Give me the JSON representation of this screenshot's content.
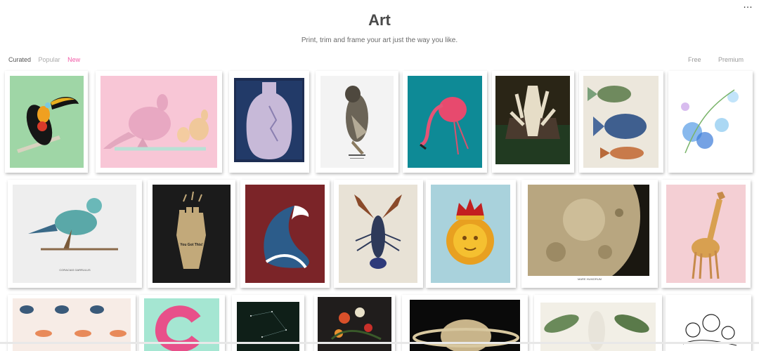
{
  "header": {
    "title": "Art",
    "subtitle": "Print, trim and frame your art just the way you like."
  },
  "menu": {
    "icon": "more-dots-icon",
    "glyph": "…"
  },
  "filters": {
    "curated": "Curated",
    "popular": "Popular",
    "new": "New",
    "active_color": "#f25aa7"
  },
  "tiers": {
    "free": "Free",
    "premium": "Premium"
  },
  "artworks": [
    {
      "name": "toucan",
      "bg": "#9fd6a6"
    },
    {
      "name": "kangaroos",
      "bg": "#f8c6d6"
    },
    {
      "name": "blue-vase",
      "bg": "#1d2d52"
    },
    {
      "name": "owl",
      "bg": "#f3f3f3"
    },
    {
      "name": "flamingo",
      "bg": "#0e8a96"
    },
    {
      "name": "skeleton-hand",
      "bg": "#213a21"
    },
    {
      "name": "fish",
      "bg": "#ece7dc"
    },
    {
      "name": "watercolor-flowers",
      "bg": "#ffffff"
    },
    {
      "name": "roller-bird",
      "bg": "#eeeeee",
      "caption": "CORACIAS GARRULUS"
    },
    {
      "name": "fist-you-got-this",
      "bg": "#1b1b1b",
      "text": "You Got This!"
    },
    {
      "name": "great-wave",
      "bg": "#7b2428"
    },
    {
      "name": "lobster",
      "bg": "#e8e2d6"
    },
    {
      "name": "sun-crown",
      "bg": "#a9d2dc"
    },
    {
      "name": "moon-crater",
      "bg": "#2a2418",
      "caption": "MARE HUMORUM"
    },
    {
      "name": "giraffe",
      "bg": "#f4cfd4"
    },
    {
      "name": "sushi-pattern",
      "bg": "#f7ece6"
    },
    {
      "name": "donut-c",
      "bg": "#a5e6d2"
    },
    {
      "name": "constellation",
      "bg": "#0f1f18"
    },
    {
      "name": "flowers-still-life",
      "bg": "#201d1c"
    },
    {
      "name": "saturn",
      "bg": "#0a0a0a"
    },
    {
      "name": "botanical-leaves",
      "bg": "#f2efe6"
    },
    {
      "name": "sketch-flowers",
      "bg": "#ffffff"
    }
  ]
}
